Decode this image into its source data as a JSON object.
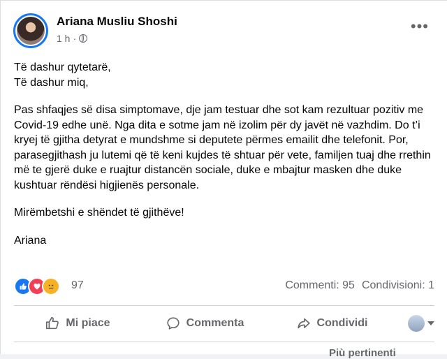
{
  "post": {
    "author": "Ariana Musliu Shoshi",
    "time": "1 h",
    "dot": "·",
    "more_icon": "•••",
    "paragraphs": [
      "Të dashur qytetarë,\nTë dashur miq,",
      "Pas shfaqjes së disa simptomave, dje jam testuar dhe sot kam rezultuar pozitiv me Covid-19 edhe unë. Nga dita e sotme jam në izolim për dy javët në vazhdim. Do t’i kryej të gjitha detyrat e mundshme si deputete përmes emailit dhe telefonit. Por, parasegjithash ju lutemi që të keni kujdes të shtuar për vete, familjen tuaj dhe rrethin më te gjerë duke e ruajtur distancën sociale, duke e mbajtur masken dhe duke  kushtuar rëndësi higjienës personale.",
      "Mirëmbetshi e shëndet të gjithëve!",
      "Ariana"
    ]
  },
  "reactions": {
    "icons": [
      "like-icon",
      "love-icon",
      "sad-icon"
    ],
    "count": "97",
    "comments": "Commenti: 95",
    "shares": "Condivisioni: 1"
  },
  "actions": {
    "like": "Mi piace",
    "comment": "Commenta",
    "share": "Condividi"
  },
  "more_comments": "Più pertinenti"
}
